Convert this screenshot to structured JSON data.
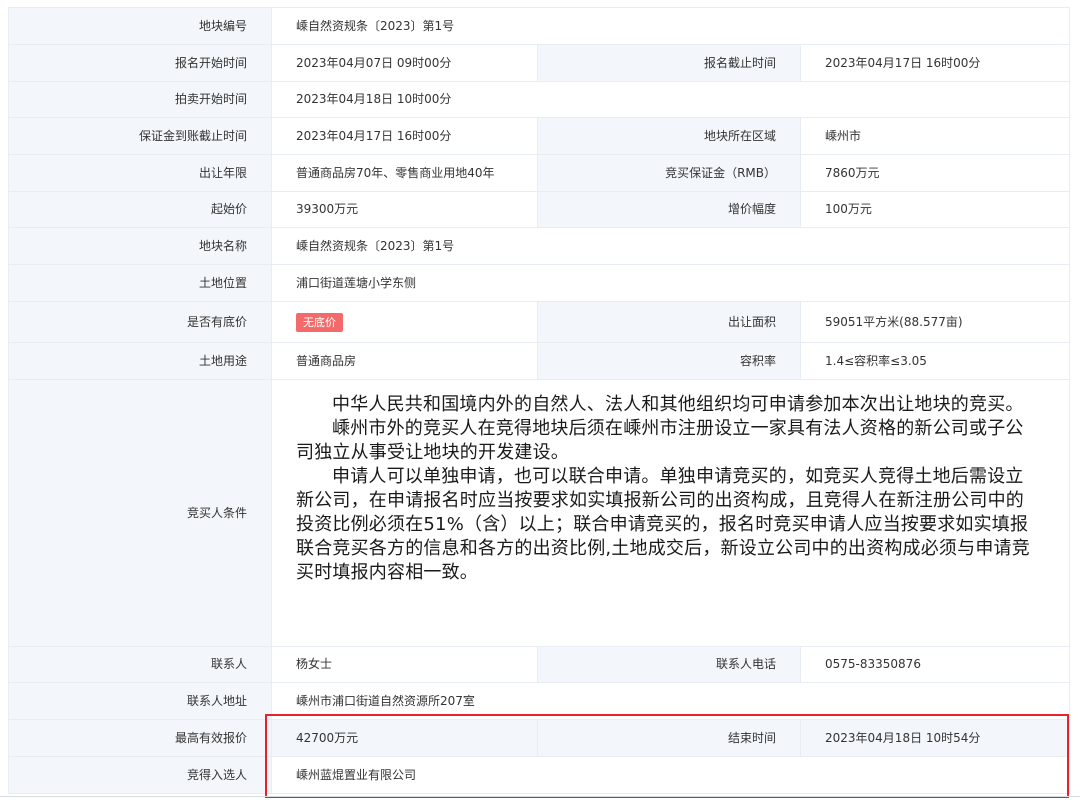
{
  "rows": {
    "plot_no": {
      "label": "地块编号",
      "value": "嵊自然资规条〔2023〕第1号"
    },
    "reg_start": {
      "label": "报名开始时间",
      "value": "2023年04月07日 09时00分"
    },
    "reg_end": {
      "label": "报名截止时间",
      "value": "2023年04月17日 16时00分"
    },
    "auction_start": {
      "label": "拍卖开始时间",
      "value": "2023年04月18日 10时00分"
    },
    "deposit_deadline": {
      "label": "保证金到账截止时间",
      "value": "2023年04月17日 16时00分"
    },
    "region": {
      "label": "地块所在区域",
      "value": "嵊州市"
    },
    "term": {
      "label": "出让年限",
      "value": "普通商品房70年、零售商业用地40年"
    },
    "deposit": {
      "label": "竞买保证金（RMB）",
      "value": "7860万元"
    },
    "start_price": {
      "label": "起始价",
      "value": "39300万元"
    },
    "increment": {
      "label": "增价幅度",
      "value": "100万元"
    },
    "plot_name": {
      "label": "地块名称",
      "value": "嵊自然资规条〔2023〕第1号"
    },
    "location": {
      "label": "土地位置",
      "value": "浦口街道莲塘小学东侧"
    },
    "reserve": {
      "label": "是否有底价",
      "value": "无底价"
    },
    "area": {
      "label": "出让面积",
      "value": "59051平方米(88.577亩)"
    },
    "usage": {
      "label": "土地用途",
      "value": "普通商品房"
    },
    "far": {
      "label": "容积率",
      "value": "1.4≤容积率≤3.05"
    },
    "conditions": {
      "label": "竞买人条件",
      "paragraphs": [
        "中华人民共和国境内外的自然人、法人和其他组织均可申请参加本次出让地块的竞买。",
        "嵊州市外的竞买人在竞得地块后须在嵊州市注册设立一家具有法人资格的新公司或子公司独立从事受让地块的开发建设。",
        "申请人可以单独申请，也可以联合申请。单独申请竞买的，如竞买人竞得土地后需设立新公司，在申请报名时应当按要求如实填报新公司的出资构成，且竞得人在新注册公司中的投资比例必须在51%（含）以上；联合申请竞买的，报名时竞买申请人应当按要求如实填报联合竞买各方的信息和各方的出资比例,土地成交后，新设立公司中的出资构成必须与申请竞买时填报内容相一致。"
      ]
    },
    "contact": {
      "label": "联系人",
      "value": "杨女士"
    },
    "phone": {
      "label": "联系人电话",
      "value": "0575-83350876"
    },
    "address": {
      "label": "联系人地址",
      "value": "嵊州市浦口街道自然资源所207室"
    },
    "top_bid": {
      "label": "最高有效报价",
      "value": "42700万元"
    },
    "end_time": {
      "label": "结束时间",
      "value": "2023年04月18日 10时54分"
    },
    "winner": {
      "label": "竞得入选人",
      "value": "嵊州蓝焜置业有限公司"
    }
  },
  "colors": {
    "label_bg": "#f3f7fb",
    "border": "#e8edf3",
    "tag_bg": "#f26a6a",
    "highlight": "#e8212a"
  }
}
